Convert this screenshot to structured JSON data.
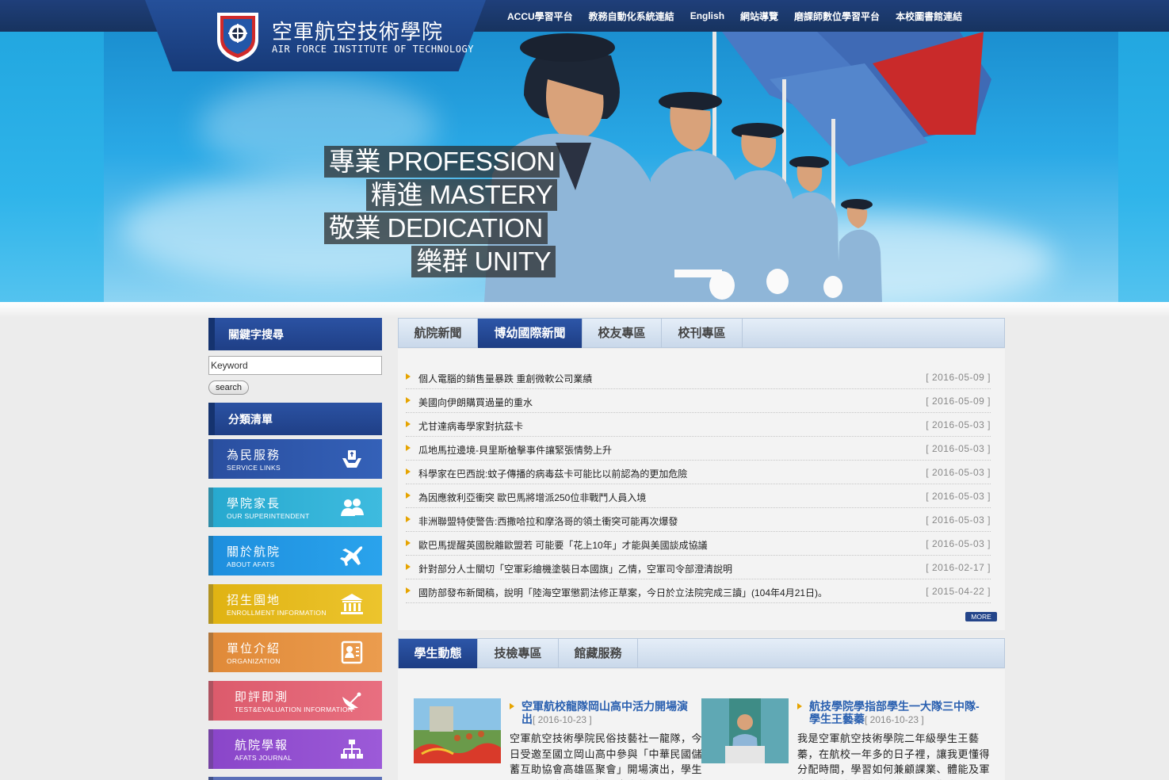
{
  "header": {
    "title_cn": "空軍航空技術學院",
    "title_en": "AIR FORCE INSTITUTE OF TECHNOLOGY",
    "nav": [
      "ACCU學習平台",
      "教務自動化系統連結",
      "English",
      "網站導覽",
      "磨課師數位學習平台",
      "本校圖書館連結"
    ]
  },
  "banner": {
    "slogans": [
      "專業 PROFESSION",
      "精進 MASTERY",
      "敬業 DEDICATION",
      "樂群 UNITY"
    ]
  },
  "sidebar": {
    "search_heading": "關鍵字搜尋",
    "keyword_value": "Keyword",
    "search_button": "search",
    "category_heading": "分類清單",
    "categories": [
      {
        "cn": "為民服務",
        "en": "SERVICE LINKS",
        "color": "#2a4fa0",
        "icon": "service-hands-icon"
      },
      {
        "cn": "學院家長",
        "en": "OUR SUPERINTENDENT",
        "color": "#27a9cf",
        "icon": "people-icon"
      },
      {
        "cn": "關於航院",
        "en": "ABOUT AFATS",
        "color": "#1e8fde",
        "icon": "airplane-icon"
      },
      {
        "cn": "招生園地",
        "en": "ENROLLMENT INFORMATION",
        "color": "#e0b313",
        "icon": "building-icon"
      },
      {
        "cn": "單位介紹",
        "en": "ORGANIZATION",
        "color": "#e08a39",
        "icon": "contact-book-icon"
      },
      {
        "cn": "即評即測",
        "en": "TEST&EVALUATION INFORMATION",
        "color": "#dc5b6c",
        "icon": "satellite-dish-icon"
      },
      {
        "cn": "航院學報",
        "en": "AFATS JOURNAL",
        "color": "#8a46c9",
        "icon": "org-chart-icon"
      }
    ]
  },
  "news_tabs": [
    "航院新聞",
    "博幼國際新聞",
    "校友專區",
    "校刊專區"
  ],
  "news": [
    {
      "title": "個人電腦的銷售量暴跌 重創微軟公司業績",
      "date": "[ 2016-05-09 ]"
    },
    {
      "title": "美國向伊朗購買過量的重水",
      "date": "[ 2016-05-09 ]"
    },
    {
      "title": "尤甘達病毒學家對抗茲卡",
      "date": "[ 2016-05-03 ]"
    },
    {
      "title": "瓜地馬拉邊境-貝里斯槍擊事件讓緊張情勢上升",
      "date": "[ 2016-05-03 ]"
    },
    {
      "title": "科學家在巴西說:蚊子傳播的病毒茲卡可能比以前認為的更加危險",
      "date": "[ 2016-05-03 ]"
    },
    {
      "title": "為因應敘利亞衝突 歐巴馬將增派250位非戰鬥人員入境",
      "date": "[ 2016-05-03 ]"
    },
    {
      "title": "非洲聯盟特使警告:西撒哈拉和摩洛哥的領土衝突可能再次爆發",
      "date": "[ 2016-05-03 ]"
    },
    {
      "title": "歐巴馬提醒英國脫離歐盟若 可能要「花上10年」才能與美國談成協議",
      "date": "[ 2016-05-03 ]"
    },
    {
      "title": "針對部分人士關切「空軍彩繪機塗裝日本國旗」乙情，空軍司令部澄清說明",
      "date": "[ 2016-02-17 ]"
    },
    {
      "title": "國防部發布新聞稿，說明「陸海空軍懲罰法修正草案，今日於立法院完成三讀」(104年4月21日)。",
      "date": "[ 2015-04-22 ]"
    }
  ],
  "more_label": "MORE",
  "student_tabs": [
    "學生動態",
    "技檢專區",
    "館藏服務"
  ],
  "student_items": [
    {
      "title": "空軍航校龍隊岡山高中活力開場演出",
      "date": "[ 2016-10-23 ]",
      "body": "空軍航空技術學院民俗技藝社一龍隊，今日受邀至國立岡山高中參與「中華民國儲蓄互助協會高雄區聚會」開場演出，學生們無不用盡全力，揮灑青春的"
    },
    {
      "title": "航技學院學指部學生一大隊三中隊-學生王藝蓁",
      "date": "[ 2016-10-23 ]",
      "body": "我是空軍航空技術學院二年級學生王藝蓁，在航校一年多的日子裡，讓我更懂得分配時間，學習如何兼顧課業、體能及軍事學能，我是前往二十聯隊服勤道"
    }
  ]
}
